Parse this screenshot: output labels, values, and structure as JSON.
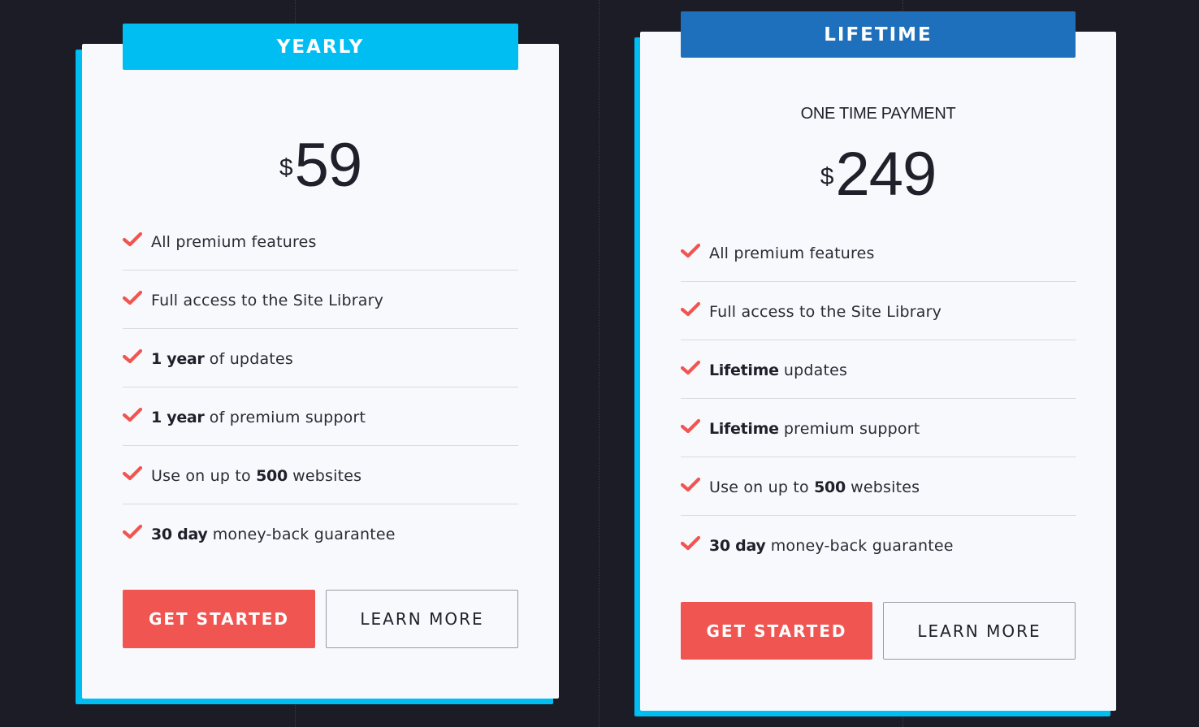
{
  "colors": {
    "background": "#1b1c26",
    "card_background": "#f8f9fd",
    "card_shadow": "#00bef2",
    "yearly_header": "#00bef2",
    "lifetime_header": "#1e70bd",
    "check": "#f15551",
    "primary_button": "#f15551",
    "text_dark": "#1f2029"
  },
  "plans": [
    {
      "title": "YEARLY",
      "subtitle": "",
      "currency": "$",
      "price": "59",
      "features": [
        {
          "icon": "check-icon",
          "bold": "",
          "text": "All premium features"
        },
        {
          "icon": "check-icon",
          "bold": "",
          "text": "Full access to the Site Library"
        },
        {
          "icon": "check-icon",
          "bold": "1 year",
          "text": " of updates"
        },
        {
          "icon": "check-icon",
          "bold": "1 year",
          "text": " of premium support"
        },
        {
          "icon": "check-icon",
          "pre": "Use on up to ",
          "bold": "500",
          "text": " websites"
        },
        {
          "icon": "check-icon",
          "bold": "30 day",
          "text": " money-back guarantee"
        }
      ],
      "primary_button": "GET STARTED",
      "secondary_button": "LEARN MORE"
    },
    {
      "title": "LIFETIME",
      "subtitle": "ONE TIME PAYMENT",
      "currency": "$",
      "price": "249",
      "features": [
        {
          "icon": "check-icon",
          "bold": "",
          "text": "All premium features"
        },
        {
          "icon": "check-icon",
          "bold": "",
          "text": "Full access to the Site Library"
        },
        {
          "icon": "check-icon",
          "bold": "Lifetime",
          "text": " updates"
        },
        {
          "icon": "check-icon",
          "bold": "Lifetime",
          "text": " premium support"
        },
        {
          "icon": "check-icon",
          "pre": "Use on up to ",
          "bold": "500",
          "text": " websites"
        },
        {
          "icon": "check-icon",
          "bold": "30 day",
          "text": " money-back guarantee"
        }
      ],
      "primary_button": "GET STARTED",
      "secondary_button": "LEARN MORE"
    }
  ]
}
